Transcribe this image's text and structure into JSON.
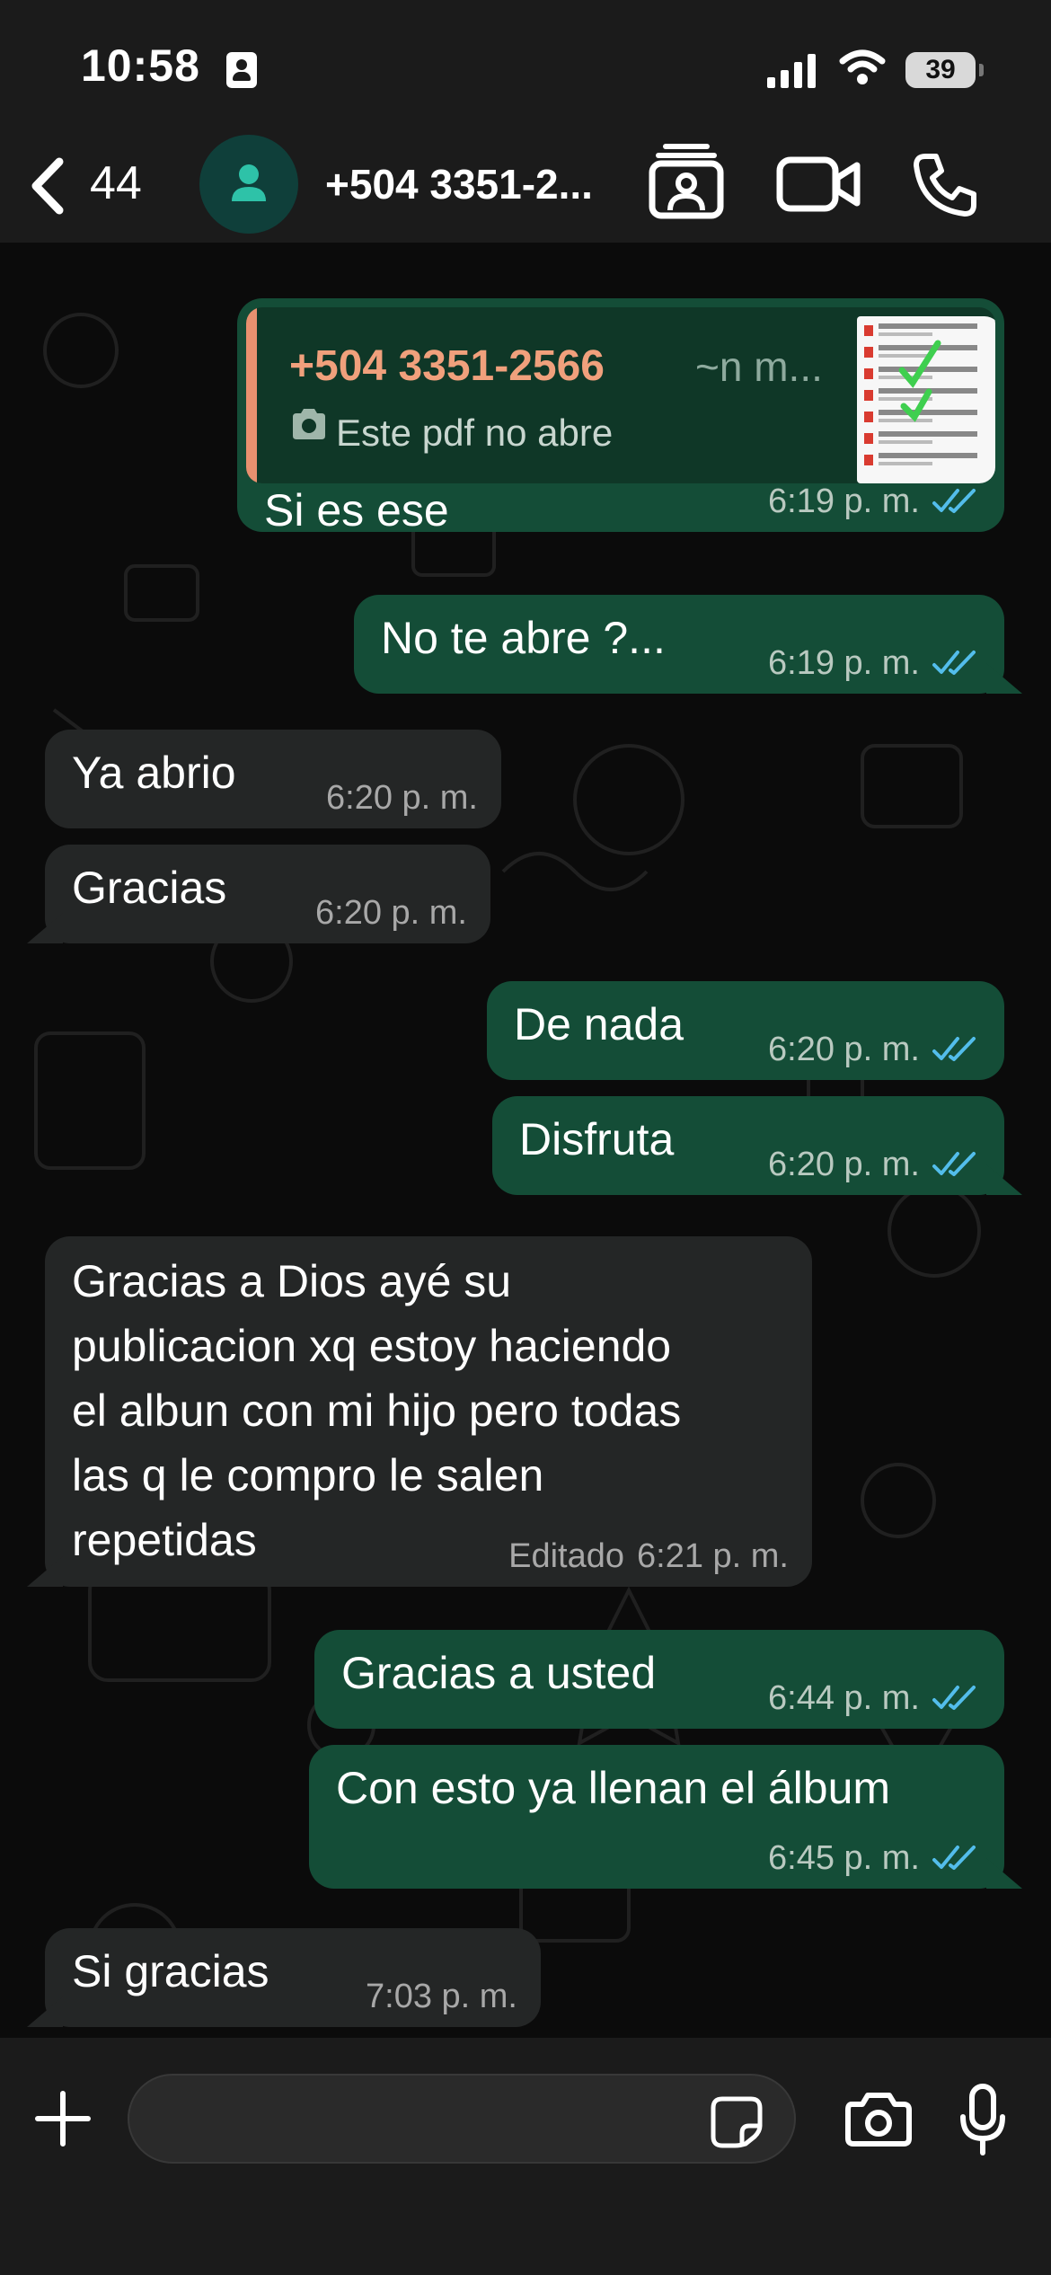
{
  "status_bar": {
    "time": "10:58",
    "battery": "39"
  },
  "header": {
    "back_count": "44",
    "contact_name": "+504 3351-2..."
  },
  "messages": [
    {
      "direction": "outgoing",
      "reply": {
        "author": "+504 3351-2566",
        "push_name": "~n m...",
        "quoted_text": "Este pdf no abre",
        "quoted_icon": "camera-icon"
      },
      "text": "Si es ese",
      "time": "6:19 p. m.",
      "status": "read"
    },
    {
      "direction": "outgoing",
      "text": "No te abre ?...",
      "time": "6:19 p. m.",
      "status": "read"
    },
    {
      "direction": "incoming",
      "text": "Ya abrio",
      "time": "6:20 p. m."
    },
    {
      "direction": "incoming",
      "text": "Gracias",
      "time": "6:20 p. m."
    },
    {
      "direction": "outgoing",
      "text": "De nada",
      "time": "6:20 p. m.",
      "status": "read"
    },
    {
      "direction": "outgoing",
      "text": "Disfruta",
      "time": "6:20 p. m.",
      "status": "read"
    },
    {
      "direction": "incoming",
      "lines": [
        "Gracias a Dios ayé su",
        "publicacion xq estoy haciendo",
        "el albun con mi hijo pero todas",
        "las q le compro le salen",
        "repetidas"
      ],
      "edited_label": "Editado",
      "time": "6:21 p. m."
    },
    {
      "direction": "outgoing",
      "text": "Gracias a usted",
      "time": "6:44 p. m.",
      "status": "read"
    },
    {
      "direction": "outgoing",
      "text": "Con esto ya llenan el álbum",
      "time": "6:45 p. m.",
      "status": "read"
    },
    {
      "direction": "incoming",
      "text": "Si gracias",
      "time": "7:03 p. m."
    }
  ],
  "input_bar": {
    "placeholder": ""
  },
  "colors": {
    "outgoing_bubble": "#144d37",
    "incoming_bubble": "#242626",
    "read_tick": "#53bdeb",
    "reply_accent": "#e8906f"
  }
}
